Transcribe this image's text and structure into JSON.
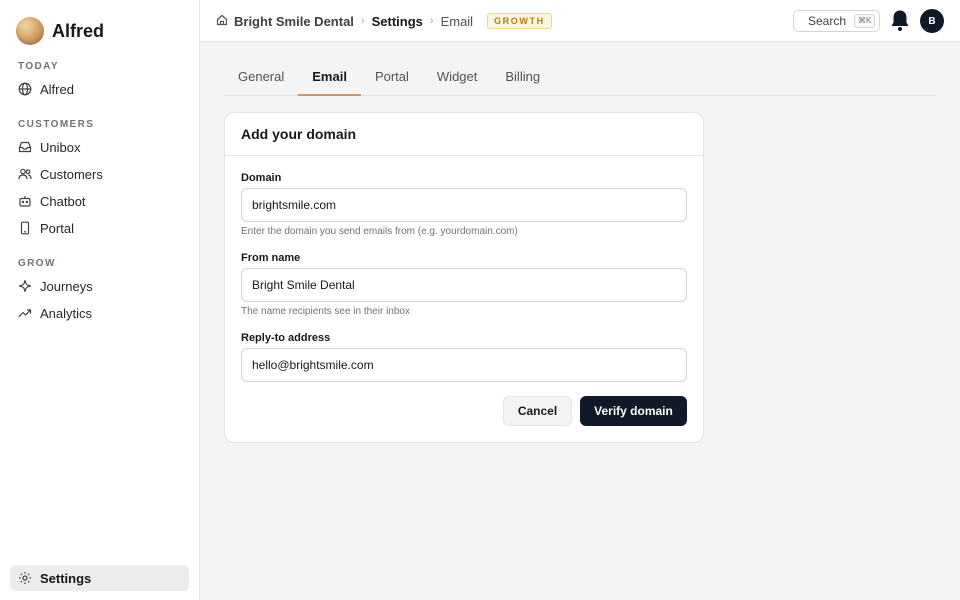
{
  "app": {
    "name": "Alfred"
  },
  "sidebar": {
    "sections": [
      {
        "label": "TODAY",
        "items": [
          {
            "label": "Alfred",
            "icon": "globe-icon"
          }
        ]
      },
      {
        "label": "CUSTOMERS",
        "items": [
          {
            "label": "Unibox",
            "icon": "inbox-icon"
          },
          {
            "label": "Customers",
            "icon": "users-icon"
          },
          {
            "label": "Chatbot",
            "icon": "bot-icon"
          },
          {
            "label": "Portal",
            "icon": "phone-icon"
          }
        ]
      },
      {
        "label": "GROW",
        "items": [
          {
            "label": "Journeys",
            "icon": "sparkle-icon"
          },
          {
            "label": "Analytics",
            "icon": "trend-icon"
          }
        ]
      }
    ],
    "footer": {
      "label": "Settings",
      "icon": "gear-icon",
      "active": true
    }
  },
  "header": {
    "breadcrumb": {
      "org": "Bright Smile Dental",
      "section": "Settings",
      "page": "Email"
    },
    "plan_badge": "GROWTH",
    "search": {
      "label": "Search",
      "shortcut": "⌘K"
    },
    "avatar_initial": "B"
  },
  "tabs": [
    {
      "label": "General",
      "active": false
    },
    {
      "label": "Email",
      "active": true
    },
    {
      "label": "Portal",
      "active": false
    },
    {
      "label": "Widget",
      "active": false
    },
    {
      "label": "Billing",
      "active": false
    }
  ],
  "form": {
    "title": "Add your domain",
    "fields": [
      {
        "label": "Domain",
        "value": "brightsmile.com",
        "help": "Enter the domain you send emails from (e.g. yourdomain.com)"
      },
      {
        "label": "From name",
        "value": "Bright Smile Dental",
        "help": "The name recipients see in their inbox"
      },
      {
        "label": "Reply-to address",
        "value": "hello@brightsmile.com",
        "help": ""
      }
    ],
    "cancel_label": "Cancel",
    "submit_label": "Verify domain"
  },
  "colors": {
    "accent": "#c8956a",
    "primary_button": "#111827",
    "badge_text": "#b7791f",
    "badge_bg": "#fef6dc"
  }
}
